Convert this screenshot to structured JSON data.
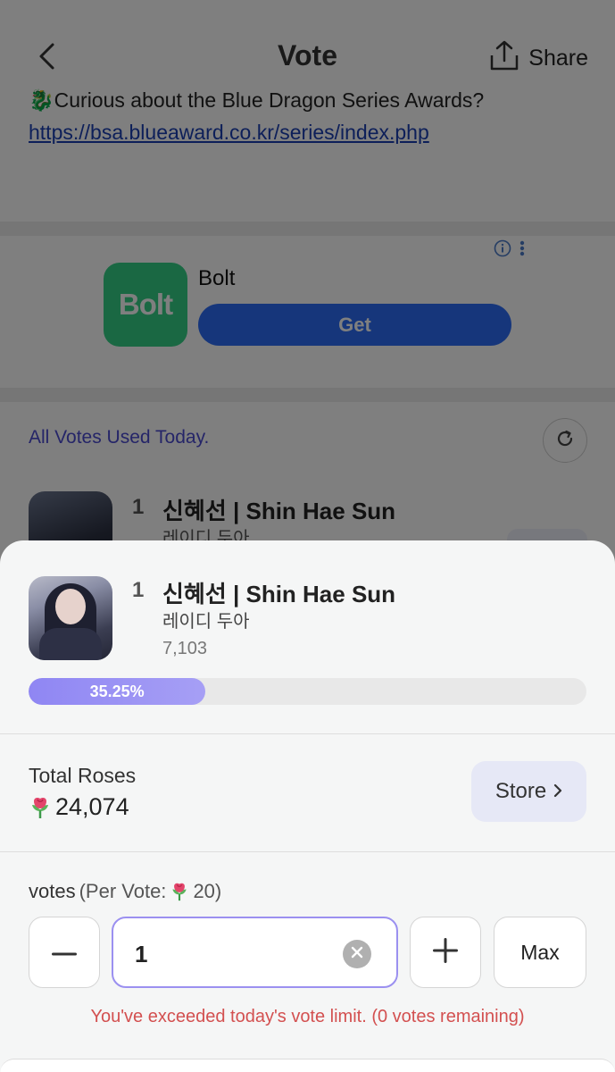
{
  "header": {
    "title": "Vote",
    "share_label": "Share"
  },
  "intro": {
    "text": "Curious about the Blue Dragon Series Awards?",
    "link": "https://bsa.blueaward.co.kr/series/index.php"
  },
  "ad": {
    "app_name": "Bolt",
    "logo_text": "Bolt",
    "cta_label": "Get"
  },
  "status": {
    "all_votes_used": "All Votes Used Today."
  },
  "list": {
    "rank": "1",
    "name": "신혜선 | Shin Hae Sun",
    "subtitle": "레이디 두아"
  },
  "sheet": {
    "rank": "1",
    "name": "신혜선 | Shin Hae Sun",
    "subtitle": "레이디 두아",
    "vote_count": "7,103",
    "percent_label": "35.25%",
    "percent_value": 35.25,
    "total_roses_label": "Total Roses",
    "total_roses_value": "24,074",
    "store_label": "Store",
    "votes_label": "votes",
    "per_vote_prefix": "(Per Vote:",
    "per_vote_value": "20)",
    "quantity_value": "1",
    "max_label": "Max",
    "error_message": "You've exceeded today's vote limit. (0 votes remaining)"
  },
  "colors": {
    "accent": "#9b90f0",
    "progress_fill": "#8f86f3",
    "error": "#d35050",
    "link": "#1a3fb3",
    "ad_button": "#2d6df6",
    "ad_logo": "#34d186"
  },
  "icons": {
    "back": "chevron-left-icon",
    "share": "share-icon",
    "refresh": "refresh-icon",
    "rose": "rose-icon",
    "store_chevron": "chevron-right-icon",
    "minus": "minus-icon",
    "plus": "plus-icon",
    "clear": "clear-icon",
    "info": "info-icon",
    "more": "more-vertical-icon"
  }
}
